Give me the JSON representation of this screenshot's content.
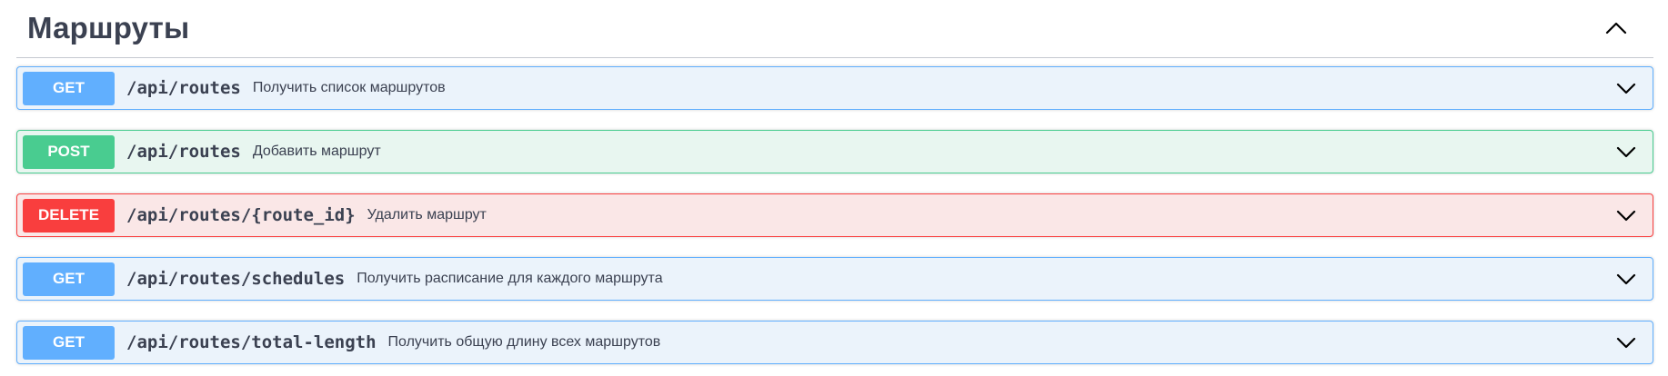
{
  "tag": {
    "title": "Маршруты",
    "toggle_icon": "chevron-up-icon"
  },
  "operations": [
    {
      "method": "GET",
      "path": "/api/routes",
      "summary": "Получить список маршрутов",
      "toggle_icon": "chevron-down-icon"
    },
    {
      "method": "POST",
      "path": "/api/routes",
      "summary": "Добавить маршрут",
      "toggle_icon": "chevron-down-icon"
    },
    {
      "method": "DELETE",
      "path": "/api/routes/{route_id}",
      "summary": "Удалить маршрут",
      "toggle_icon": "chevron-down-icon"
    },
    {
      "method": "GET",
      "path": "/api/routes/schedules",
      "summary": "Получить расписание для каждого маршрута",
      "toggle_icon": "chevron-down-icon"
    },
    {
      "method": "GET",
      "path": "/api/routes/total-length",
      "summary": "Получить общую длину всех маршрутов",
      "toggle_icon": "chevron-down-icon"
    }
  ],
  "colors": {
    "get": "#61affe",
    "post": "#49cc90",
    "delete": "#f93e3e",
    "text": "#3b4151"
  }
}
